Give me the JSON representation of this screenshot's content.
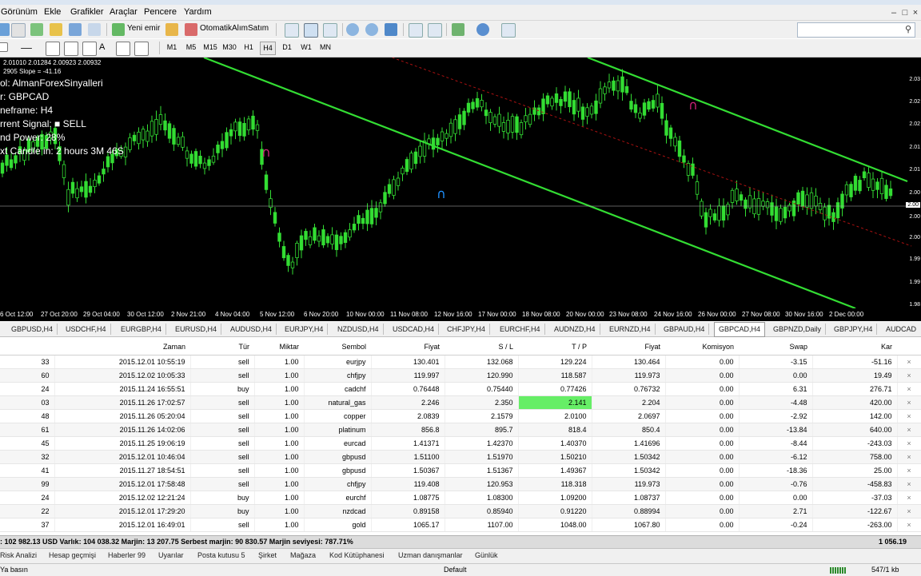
{
  "menu": {
    "items": [
      "Görünüm",
      "Ekle",
      "Grafikler",
      "Araçlar",
      "Pencere",
      "Yardım"
    ]
  },
  "toolbar": {
    "new_order": "Yeni emir",
    "autotrading": "OtomatikAlımSatım",
    "timeframes": [
      "M1",
      "M5",
      "M15",
      "M30",
      "H1",
      "H4",
      "D1",
      "W1",
      "MN"
    ],
    "active_timeframe": "H4"
  },
  "chart": {
    "top_info_1": "2.01010 2.01284 2.00923 2.00932",
    "top_info_2": "2905 Slope = -41.16",
    "panel": [
      "ol: AlmanForexSinyalleri",
      "r: GBPCAD",
      "neframe: H4",
      "rrent Signal: ■ SELL",
      "nd Power: 28%",
      "xt Candle in: 2 hours 3M 46S"
    ],
    "price_labels": [
      "2.03",
      "2.02",
      "2.02",
      "2.01",
      "2.01",
      "2.00",
      "2.00",
      "2.00",
      "1.99",
      "1.99",
      "1.98"
    ],
    "current_price": "2.00",
    "time_labels": [
      "6 Oct 12:00",
      "27 Oct 20:00",
      "29 Oct 04:00",
      "30 Oct 12:00",
      "2 Nov 21:00",
      "4 Nov 04:00",
      "5 Nov 12:00",
      "6 Nov 20:00",
      "10 Nov 00:00",
      "11 Nov 08:00",
      "12 Nov 16:00",
      "17 Nov 00:00",
      "18 Nov 08:00",
      "20 Nov 00:00",
      "23 Nov 08:00",
      "24 Nov 16:00",
      "26 Nov 00:00",
      "27 Nov 08:00",
      "30 Nov 16:00",
      "2 Dec 00:00"
    ],
    "colors": {
      "channel": "#33dd33",
      "candle": "#33dd33",
      "arrow_sell": "#cc2277",
      "arrow_buy": "#1e90ff",
      "trendline": "#aa1111"
    }
  },
  "chart_tabs": [
    "GBPUSD,H4",
    "USDCHF,H4",
    "EURGBP,H4",
    "EURUSD,H4",
    "AUDUSD,H4",
    "EURJPY,H4",
    "NZDUSD,H4",
    "USDCAD,H4",
    "CHFJPY,H4",
    "EURCHF,H4",
    "AUDNZD,H4",
    "EURNZD,H4",
    "GBPAUD,H4",
    "GBPCAD,H4",
    "GBPNZD,Daily",
    "GBPJPY,H4",
    "AUDCAD"
  ],
  "active_chart_tab": "GBPCAD,H4",
  "terminal": {
    "columns": [
      "",
      "Zaman",
      "Tür",
      "Miktar",
      "Sembol",
      "Fiyat",
      "S / L",
      "T / P",
      "Fiyat",
      "Komisyon",
      "Swap",
      "Kar",
      ""
    ],
    "rows": [
      [
        "33",
        "2015.12.01 10:55:19",
        "sell",
        "1.00",
        "eurjpy",
        "130.401",
        "132.068",
        "129.224",
        "130.464",
        "0.00",
        "-3.15",
        "-51.16"
      ],
      [
        "60",
        "2015.12.02 10:05:33",
        "sell",
        "1.00",
        "chfjpy",
        "119.997",
        "120.990",
        "118.587",
        "119.973",
        "0.00",
        "0.00",
        "19.49"
      ],
      [
        "24",
        "2015.11.24 16:55:51",
        "buy",
        "1.00",
        "cadchf",
        "0.76448",
        "0.75440",
        "0.77426",
        "0.76732",
        "0.00",
        "6.31",
        "276.71"
      ],
      [
        "03",
        "2015.11.26 17:02:57",
        "sell",
        "1.00",
        "natural_gas",
        "2.246",
        "2.350",
        "2.141",
        "2.204",
        "0.00",
        "-4.48",
        "420.00"
      ],
      [
        "48",
        "2015.11.26 05:20:04",
        "sell",
        "1.00",
        "copper",
        "2.0839",
        "2.1579",
        "2.0100",
        "2.0697",
        "0.00",
        "-2.92",
        "142.00"
      ],
      [
        "61",
        "2015.11.26 14:02:06",
        "sell",
        "1.00",
        "platinum",
        "856.8",
        "895.7",
        "818.4",
        "850.4",
        "0.00",
        "-13.84",
        "640.00"
      ],
      [
        "45",
        "2015.11.25 19:06:19",
        "sell",
        "1.00",
        "eurcad",
        "1.41371",
        "1.42370",
        "1.40370",
        "1.41696",
        "0.00",
        "-8.44",
        "-243.03"
      ],
      [
        "32",
        "2015.12.01 10:46:04",
        "sell",
        "1.00",
        "gbpusd",
        "1.51100",
        "1.51970",
        "1.50210",
        "1.50342",
        "0.00",
        "-6.12",
        "758.00"
      ],
      [
        "41",
        "2015.11.27 18:54:51",
        "sell",
        "1.00",
        "gbpusd",
        "1.50367",
        "1.51367",
        "1.49367",
        "1.50342",
        "0.00",
        "-18.36",
        "25.00"
      ],
      [
        "99",
        "2015.12.01 17:58:48",
        "sell",
        "1.00",
        "chfjpy",
        "119.408",
        "120.953",
        "118.318",
        "119.973",
        "0.00",
        "-0.76",
        "-458.83"
      ],
      [
        "24",
        "2015.12.02 12:21:24",
        "buy",
        "1.00",
        "eurchf",
        "1.08775",
        "1.08300",
        "1.09200",
        "1.08737",
        "0.00",
        "0.00",
        "-37.03"
      ],
      [
        "22",
        "2015.12.01 17:29:20",
        "buy",
        "1.00",
        "nzdcad",
        "0.89158",
        "0.85940",
        "0.91220",
        "0.88994",
        "0.00",
        "2.71",
        "-122.67"
      ],
      [
        "37",
        "2015.12.01 16:49:01",
        "sell",
        "1.00",
        "gold",
        "1065.17",
        "1107.00",
        "1048.00",
        "1067.80",
        "0.00",
        "-0.24",
        "-263.00"
      ]
    ],
    "highlight_color": "#66ee66",
    "balance_text": ": 102 982.13 USD  Varlık: 104 038.32  Marjin: 13 207.75  Serbest marjin: 90 830.57  Marjin seviyesi: 787.71%",
    "balance_total": "1 056.19"
  },
  "terminal_tabs": [
    "Risk Analizi",
    "Hesap geçmişi",
    "Haberler 99",
    "Uyarılar",
    "Posta kutusu 5",
    "Şirket",
    "Mağaza",
    "Kod Kütüphanesi",
    "Uzman danışmanlar",
    "Günlük"
  ],
  "status": {
    "left": "Ya basın",
    "profile": "Default",
    "traffic": "547/1 kb"
  }
}
